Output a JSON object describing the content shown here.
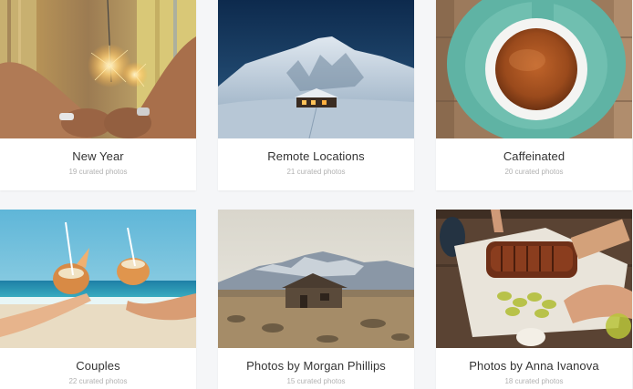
{
  "collections": [
    {
      "title": "New Year",
      "count": "19 curated photos",
      "image": "sparkler-hands-photo"
    },
    {
      "title": "Remote Locations",
      "count": "21 curated photos",
      "image": "snowy-cabin-photo"
    },
    {
      "title": "Caffeinated",
      "count": "20 curated photos",
      "image": "coffee-cup-photo"
    },
    {
      "title": "Couples",
      "count": "22 curated photos",
      "image": "coconut-drinks-photo"
    },
    {
      "title": "Photos by Morgan Phillips",
      "count": "15 curated photos",
      "image": "desert-shack-photo"
    },
    {
      "title": "Photos by Anna Ivanova",
      "count": "18 curated photos",
      "image": "ribs-feast-photo"
    }
  ]
}
